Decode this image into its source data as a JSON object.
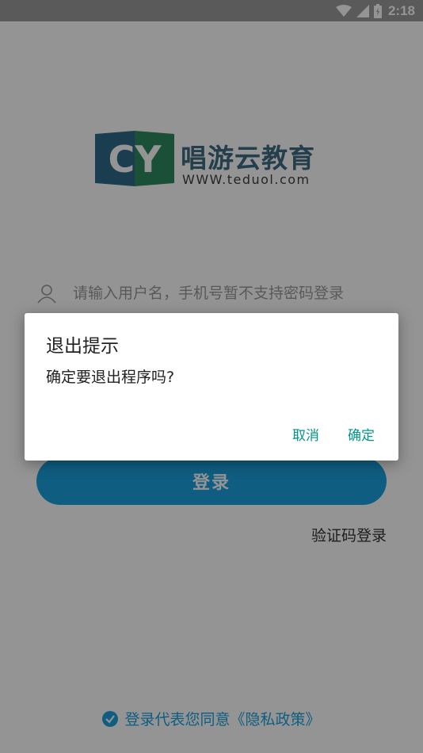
{
  "status_bar": {
    "time": "2:18",
    "icons": [
      "wifi-icon",
      "signal-icon",
      "battery-icon"
    ]
  },
  "logo": {
    "mark_text": "CY",
    "title": "唱游云教育",
    "url": "WWW.teduol.com"
  },
  "login_form": {
    "username": {
      "value": "",
      "placeholder": "请输入用户名，手机号暂不支持密码登录",
      "icon": "user-icon"
    },
    "login_button_label": "登录",
    "sms_login_link": "验证码登录"
  },
  "policy": {
    "text": "登录代表您同意《隐私政策》",
    "checked": true
  },
  "dialog": {
    "title": "退出提示",
    "message": "确定要退出程序吗?",
    "cancel_label": "取消",
    "confirm_label": "确定"
  },
  "colors": {
    "accent": "#1aa3e0",
    "dialog_button": "#009688",
    "logo_blue": "#3e6b83",
    "logo_green": "#2e7d5b"
  }
}
